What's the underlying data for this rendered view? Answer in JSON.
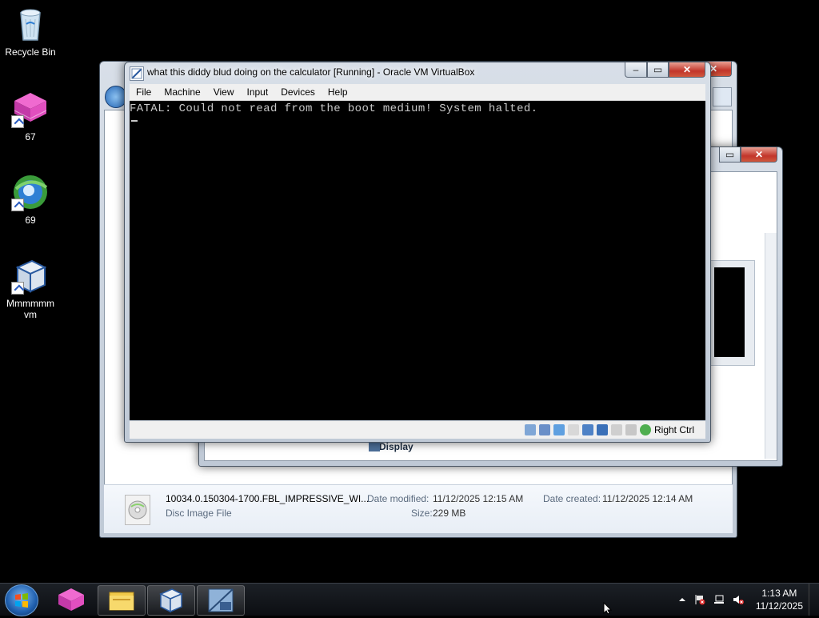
{
  "desktop": {
    "icons": [
      {
        "label": "Recycle Bin"
      },
      {
        "label": "67"
      },
      {
        "label": "69"
      },
      {
        "label": "Mmmmmm vm"
      }
    ]
  },
  "explorer": {
    "file_name": "10034.0.150304-1700.FBL_IMPRESSIVE_WI...",
    "file_type": "Disc Image File",
    "date_modified_label": "Date modified:",
    "date_modified": "11/12/2025 12:15 AM",
    "size_label": "Size:",
    "size": "229 MB",
    "date_created_label": "Date created:",
    "date_created": "11/12/2025 12:14 AM"
  },
  "dialog2": {
    "display_label": "Display"
  },
  "vbox": {
    "title": "what this diddy blud doing on the calculator [Running] - Oracle VM VirtualBox",
    "menu": [
      "File",
      "Machine",
      "View",
      "Input",
      "Devices",
      "Help"
    ],
    "console_text": "FATAL: Could not read from the boot medium! System halted.",
    "host_key": "Right Ctrl"
  },
  "taskbar": {
    "time": "1:13 AM",
    "date": "11/12/2025",
    "pinned": [
      "start-button",
      "app-67",
      "file-explorer",
      "virtualbox",
      "win10-setup"
    ]
  },
  "colors": {
    "close_button": "#c2352a",
    "taskbar": "#0c0e12",
    "console_text": "#c8c8c8"
  }
}
